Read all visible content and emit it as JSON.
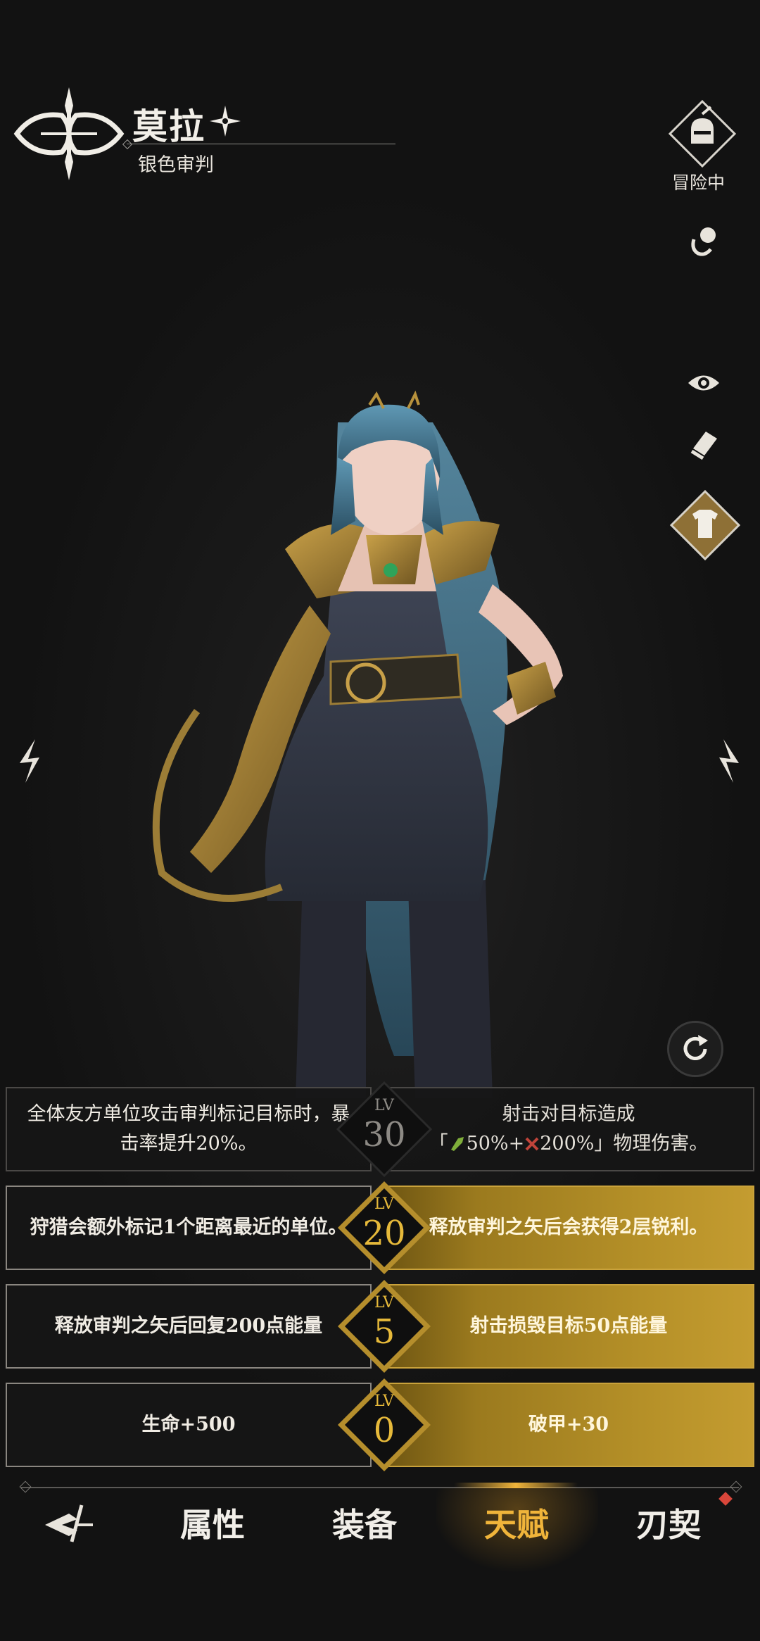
{
  "header": {
    "name": "莫拉",
    "title": "银色审判"
  },
  "sidebar": {
    "status_label": "冒险中"
  },
  "talents": [
    {
      "level_prefix": "LV",
      "level": "30",
      "state": "locked",
      "left": "全体友方单位攻击审判标记目标时，暴击率提升20%。",
      "right_line1": "射击对目标造成",
      "right_line2_prefix": "「",
      "right_atk_pct": "50%+",
      "right_def_pct": "200%",
      "right_line2_suffix": "」物理伤害。"
    },
    {
      "level_prefix": "LV",
      "level": "20",
      "state": "active",
      "left": "狩猎会额外标记1个距离最近的单位。",
      "right": "释放审判之矢后会获得2层锐利。"
    },
    {
      "level_prefix": "LV",
      "level": "5",
      "state": "active",
      "left": "释放审判之矢后回复200点能量",
      "right": "射击损毁目标50点能量"
    },
    {
      "level_prefix": "LV",
      "level": "0",
      "state": "active",
      "left": "生命+500",
      "right": "破甲+30"
    }
  ],
  "bottom_nav": {
    "tabs": [
      "属性",
      "装备",
      "天赋",
      "刃契"
    ],
    "active_tab": "天赋"
  },
  "colors": {
    "gold": "#f0b43a",
    "panel": "#161616",
    "notice": "#d9463a"
  }
}
